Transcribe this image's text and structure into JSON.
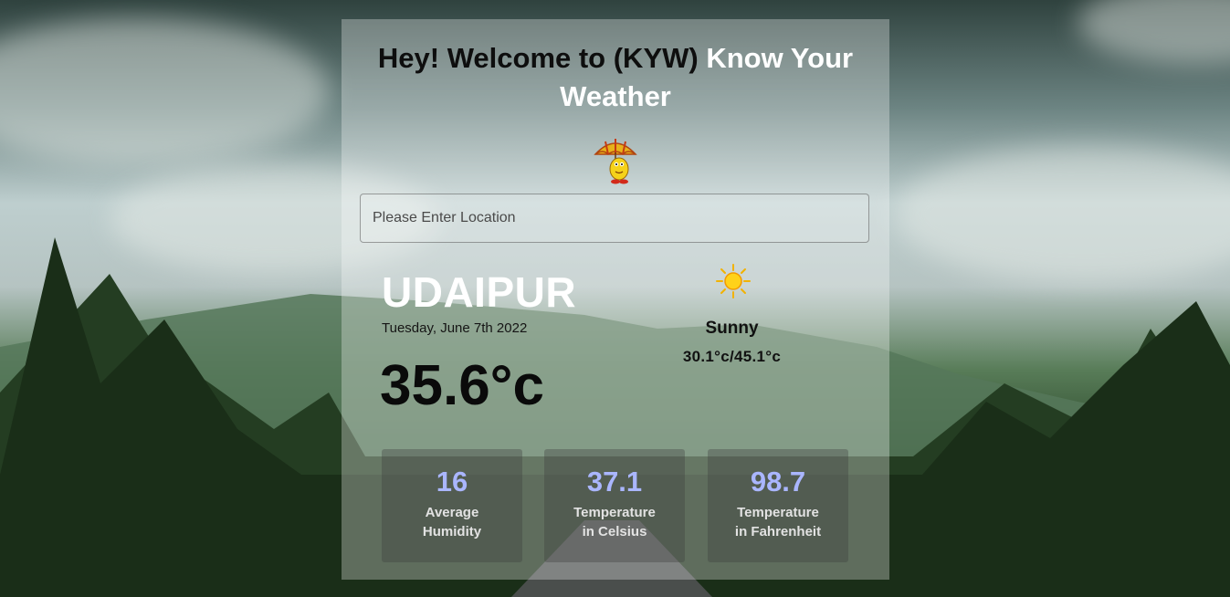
{
  "header": {
    "title_part1": "Hey! Welcome to (KYW)",
    "title_part2": "Know Your Weather"
  },
  "search": {
    "placeholder": "Please Enter Location",
    "value": ""
  },
  "weather": {
    "city": "UDAIPUR",
    "date": "Tuesday, June 7th 2022",
    "temperature": "35.6°c",
    "condition": "Sunny",
    "condition_icon": "sun-icon",
    "min_max": "30.1°c/45.1°c"
  },
  "stats": [
    {
      "value": "16",
      "label_line1": "Average",
      "label_line2": "Humidity"
    },
    {
      "value": "37.1",
      "label_line1": "Temperature",
      "label_line2": "in Celsius"
    },
    {
      "value": "98.7",
      "label_line1": "Temperature",
      "label_line2": "in Fahrenheit"
    }
  ],
  "colors": {
    "stat_value": "#aab6ff",
    "city": "#ffffff",
    "card_overlay": "rgba(255,255,255,0.30)"
  }
}
